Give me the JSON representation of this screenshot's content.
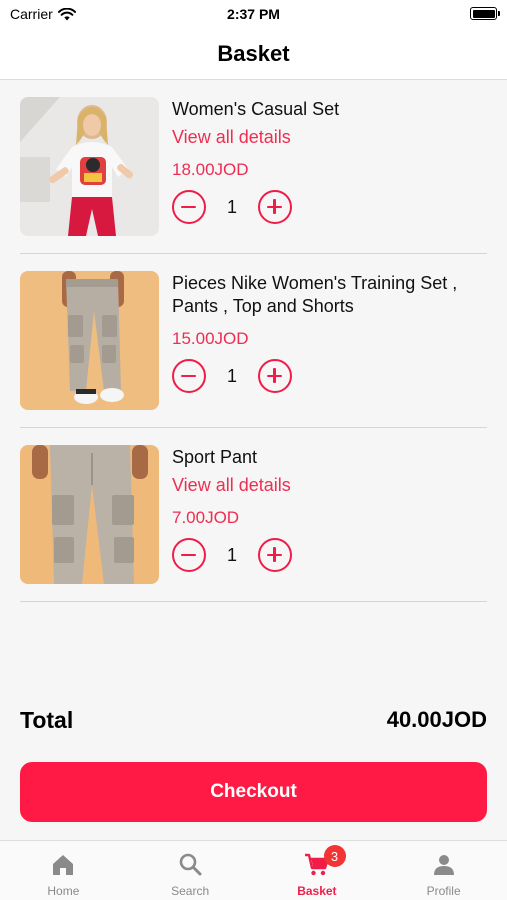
{
  "status_bar": {
    "carrier": "Carrier",
    "time": "2:37 PM"
  },
  "header": {
    "title": "Basket"
  },
  "items": [
    {
      "name": "Women's Casual Set",
      "link": "View all details",
      "price": "18.00JOD",
      "quantity": "1",
      "image_icon": "womens-casual-set-photo"
    },
    {
      "name": "Pieces  Nike Women's Training Set , Pants , Top and Shorts",
      "link": "",
      "price": "15.00JOD",
      "quantity": "1",
      "image_icon": "cargo-pants-photo"
    },
    {
      "name": "Sport Pant",
      "link": "View all details",
      "price": "7.00JOD",
      "quantity": "1",
      "image_icon": "sport-pant-photo"
    }
  ],
  "summary": {
    "total_label": "Total",
    "total_value": "40.00JOD"
  },
  "checkout": {
    "label": "Checkout"
  },
  "tabs": [
    {
      "label": "Home",
      "icon": "home-icon"
    },
    {
      "label": "Search",
      "icon": "search-icon"
    },
    {
      "label": "Basket",
      "icon": "cart-icon",
      "badge": "3",
      "active": true
    },
    {
      "label": "Profile",
      "icon": "person-icon"
    }
  ],
  "colors": {
    "accent": "#ef1d48",
    "button": "#ff1a45",
    "badge": "#f13434",
    "tab_inactive": "#8a8a8a"
  }
}
